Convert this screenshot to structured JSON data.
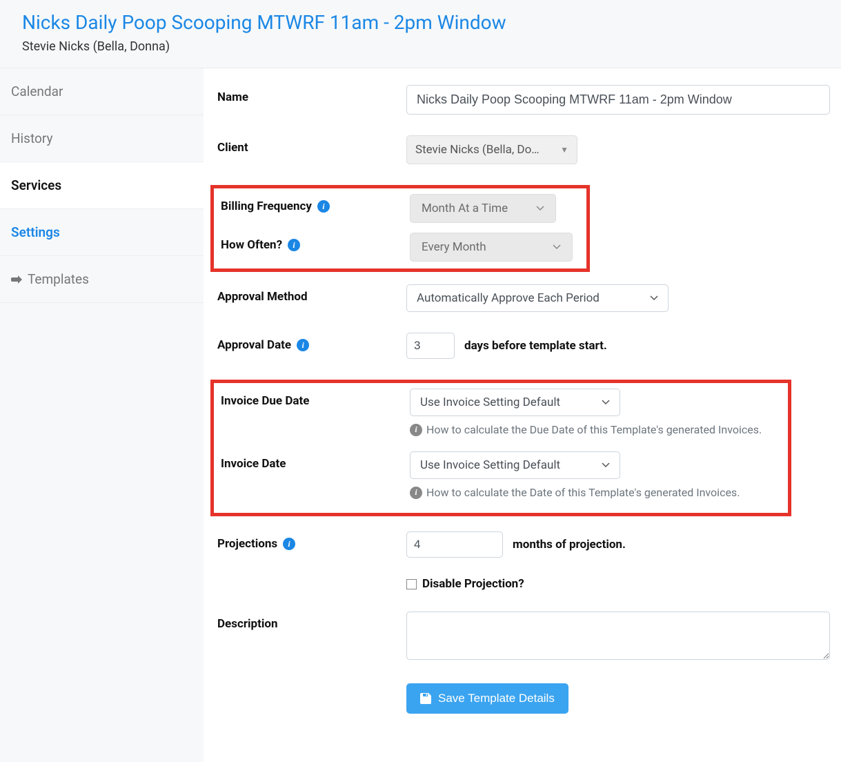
{
  "header": {
    "title": "Nicks Daily Poop Scooping MTWRF 11am - 2pm Window",
    "subtitle": "Stevie Nicks (Bella, Donna)"
  },
  "sidebar": {
    "calendar": "Calendar",
    "history": "History",
    "services": "Services",
    "settings": "Settings",
    "templates": "Templates"
  },
  "form": {
    "name_label": "Name",
    "name_value": "Nicks Daily Poop Scooping MTWRF 11am - 2pm Window",
    "client_label": "Client",
    "client_value": "Stevie Nicks (Bella, Do…",
    "billing_freq_label": "Billing Frequency",
    "billing_freq_value": "Month At a Time",
    "how_often_label": "How Often?",
    "how_often_value": "Every Month",
    "approval_method_label": "Approval Method",
    "approval_method_value": "Automatically Approve Each Period",
    "approval_date_label": "Approval Date",
    "approval_date_value": "3",
    "approval_date_suffix": "days before template start.",
    "invoice_due_label": "Invoice Due Date",
    "invoice_due_value": "Use Invoice Setting Default",
    "invoice_due_help": "How to calculate the Due Date of this Template's generated Invoices.",
    "invoice_date_label": "Invoice Date",
    "invoice_date_value": "Use Invoice Setting Default",
    "invoice_date_help": "How to calculate the Date of this Template's generated Invoices.",
    "projections_label": "Projections",
    "projections_value": "4",
    "projections_suffix": "months of projection.",
    "disable_projection_label": "Disable Projection?",
    "description_label": "Description",
    "save_button": "Save Template Details"
  }
}
